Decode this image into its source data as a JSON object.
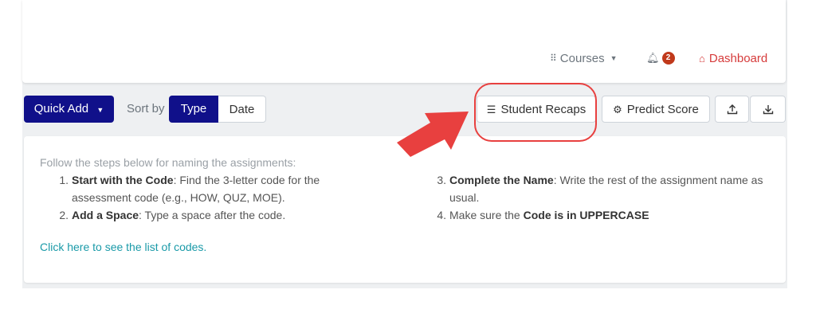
{
  "nav": {
    "courses_label": "Courses",
    "notification_count": "2",
    "dashboard_label": "Dashboard"
  },
  "toolbar": {
    "quick_add_label": "Quick Add",
    "sort_by_label": "Sort by",
    "sort_options": [
      "Type",
      "Date"
    ],
    "sort_selected": "Type",
    "student_recaps_label": "Student Recaps",
    "predict_score_label": "Predict Score"
  },
  "instructions": {
    "intro": "Follow the steps below for naming the assignments:",
    "steps": [
      {
        "num": "1.",
        "bold": "Start with the Code",
        "text": ": Find the 3-letter code for the assessment code (e.g., HOW, QUZ, MOE)."
      },
      {
        "num": "2.",
        "bold": "Add a Space",
        "text": ": Type a space after the code."
      },
      {
        "num": "3.",
        "bold": "Complete the Name",
        "text": ": Write the rest of the assignment name as usual."
      },
      {
        "num": "4.",
        "pre": "Make sure the ",
        "bold": "Code is in UPPERCASE"
      }
    ],
    "link_text": "Click here to see the list of codes."
  },
  "colors": {
    "primary": "#10108a",
    "highlight": "#e8403f",
    "dashboard": "#d63b3b",
    "badge": "#c0391b",
    "link": "#1a9aa8"
  },
  "icons": [
    "grid-icon",
    "bell-icon",
    "home-icon",
    "list-icon",
    "gear-icon",
    "upload-icon",
    "download-icon",
    "arrow-annotation"
  ]
}
